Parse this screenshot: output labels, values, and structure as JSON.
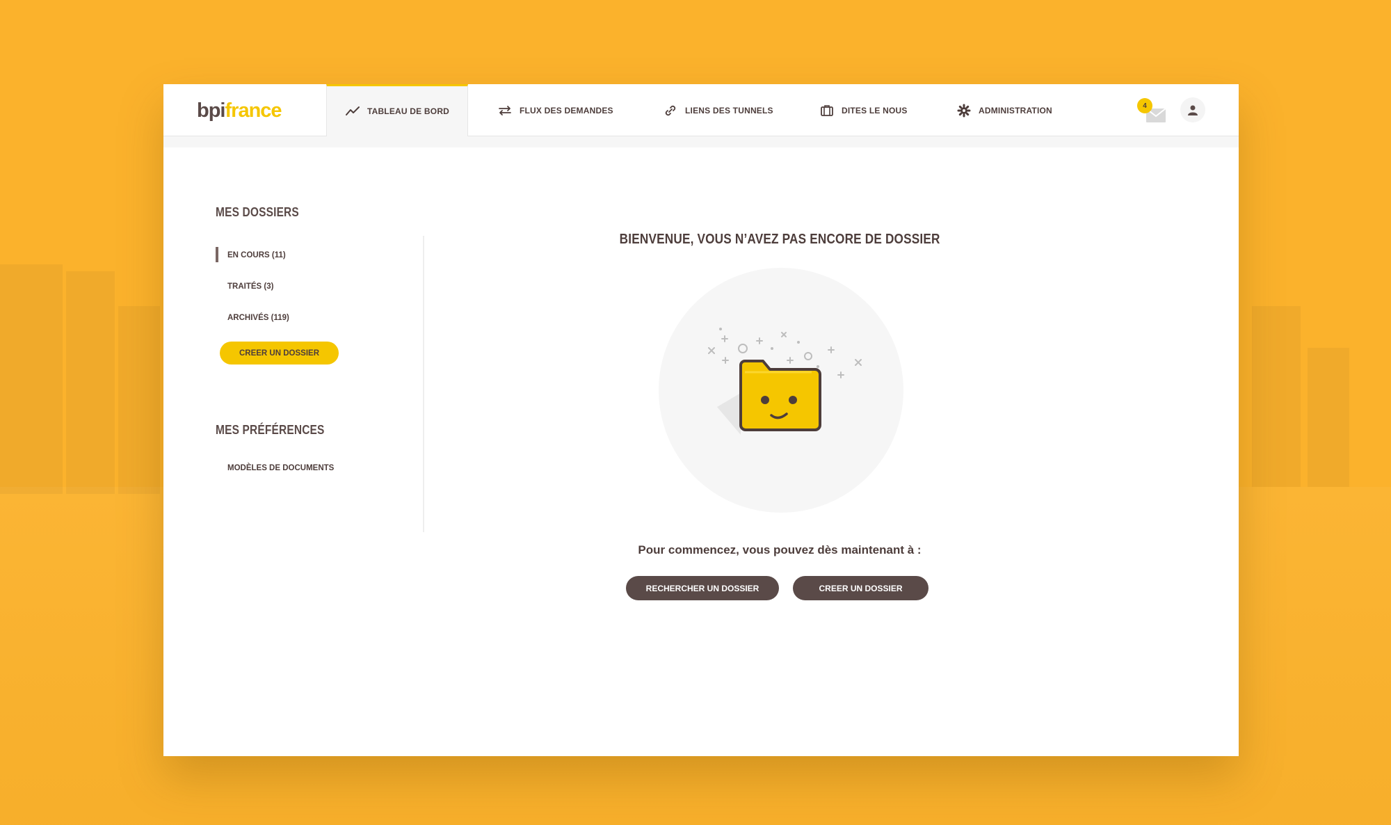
{
  "brand": {
    "part1": "bpi",
    "part2": "france"
  },
  "nav": [
    {
      "label": "TABLEAU DE BORD",
      "icon": "trend-icon",
      "active": true
    },
    {
      "label": "FLUX DES DEMANDES",
      "icon": "swap-arrows-icon"
    },
    {
      "label": "LIENS DES TUNNELS",
      "icon": "link-icon"
    },
    {
      "label": "DITES LE NOUS",
      "icon": "briefcase-icon"
    },
    {
      "label": "ADMINISTRATION",
      "icon": "gear-icon"
    }
  ],
  "notifications": {
    "count": "4",
    "icon": "mail-icon"
  },
  "user": {
    "icon": "user-icon"
  },
  "sidebar": {
    "dossiers_title": "MES DOSSIERS",
    "items": [
      {
        "label": "EN COURS (11)",
        "active": true
      },
      {
        "label": "TRAITÉS (3)"
      },
      {
        "label": "ARCHIVÉS (119)"
      }
    ],
    "create_label": "CREER UN DOSSIER",
    "preferences_title": "MES PRÉFÉRENCES",
    "pref_items": [
      {
        "label": "MODÈLES DE DOCUMENTS"
      }
    ]
  },
  "main": {
    "welcome": "BIENVENUE, VOUS N’AVEZ PAS ENCORE DE DOSSIER",
    "intro": "Pour commencez, vous pouvez dès maintenant à :",
    "search_label": "RECHERCHER UN DOSSIER",
    "create_label": "CREER UN DOSSIER"
  },
  "colors": {
    "background": "#fbb22c",
    "accent": "#f5c600",
    "dark": "#5a4a48"
  }
}
